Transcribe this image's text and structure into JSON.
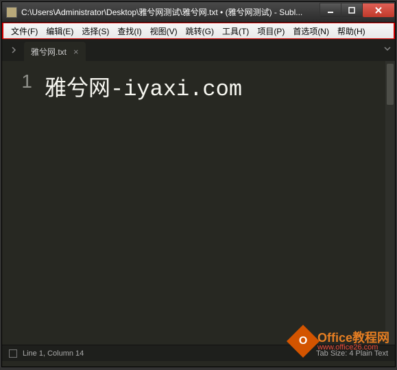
{
  "title": "C:\\Users\\Administrator\\Desktop\\雅兮网测试\\雅兮网.txt • (雅兮网测试) - Subl...",
  "menu": {
    "file": "文件(F)",
    "edit": "编辑(E)",
    "select": "选择(S)",
    "find": "查找(I)",
    "view": "视图(V)",
    "goto": "跳转(G)",
    "tools": "工具(T)",
    "project": "项目(P)",
    "preferences": "首选项(N)",
    "help": "帮助(H)"
  },
  "tab": {
    "name": "雅兮网.txt",
    "close": "×"
  },
  "editor": {
    "line_numbers": [
      "1"
    ],
    "content": "雅兮网-iyaxi.com"
  },
  "status": {
    "left": "Line 1, Column 14",
    "right": "Tab Size: 4    Plain Text"
  },
  "watermark": {
    "badge": "O",
    "line1": "Office教程网",
    "line2": "www.office26.com"
  }
}
